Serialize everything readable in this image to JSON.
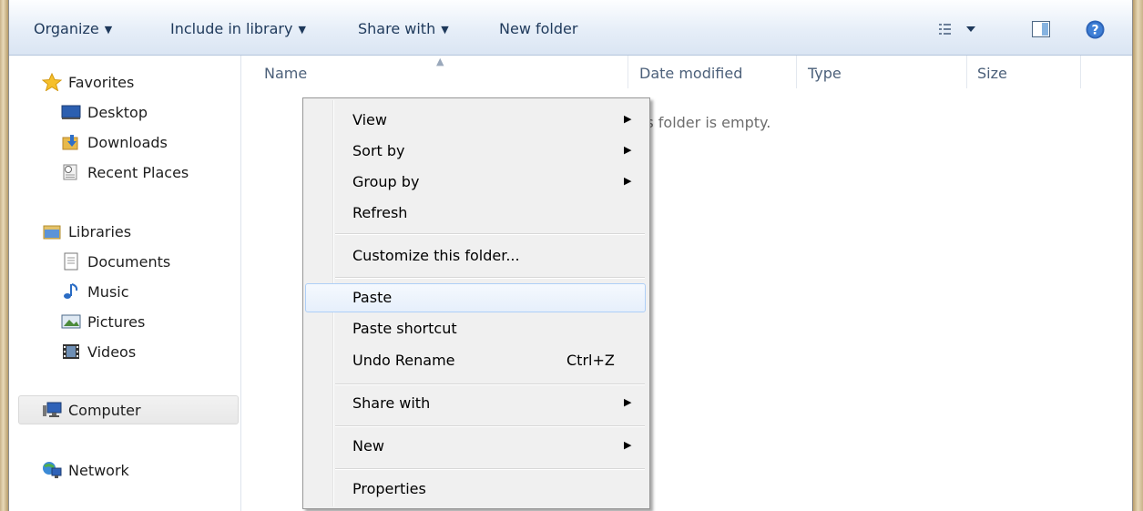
{
  "toolbar": {
    "organize": "Organize",
    "include_in_library": "Include in library",
    "share_with": "Share with",
    "new_folder": "New folder"
  },
  "nav": {
    "favorites": "Favorites",
    "desktop": "Desktop",
    "downloads": "Downloads",
    "recent_places": "Recent Places",
    "libraries": "Libraries",
    "documents": "Documents",
    "music": "Music",
    "pictures": "Pictures",
    "videos": "Videos",
    "computer": "Computer",
    "network": "Network"
  },
  "columns": {
    "name": "Name",
    "date_modified": "Date modified",
    "type": "Type",
    "size": "Size"
  },
  "empty_message": "This folder is empty.",
  "context_menu": {
    "view": "View",
    "sort_by": "Sort by",
    "group_by": "Group by",
    "refresh": "Refresh",
    "customize": "Customize this folder...",
    "paste": "Paste",
    "paste_shortcut": "Paste shortcut",
    "undo_rename": "Undo Rename",
    "undo_shortcut": "Ctrl+Z",
    "share_with": "Share with",
    "new": "New",
    "properties": "Properties"
  },
  "icons": {
    "help": "help-icon",
    "preview_pane": "preview-pane-icon",
    "view_options": "view-options-icon"
  }
}
